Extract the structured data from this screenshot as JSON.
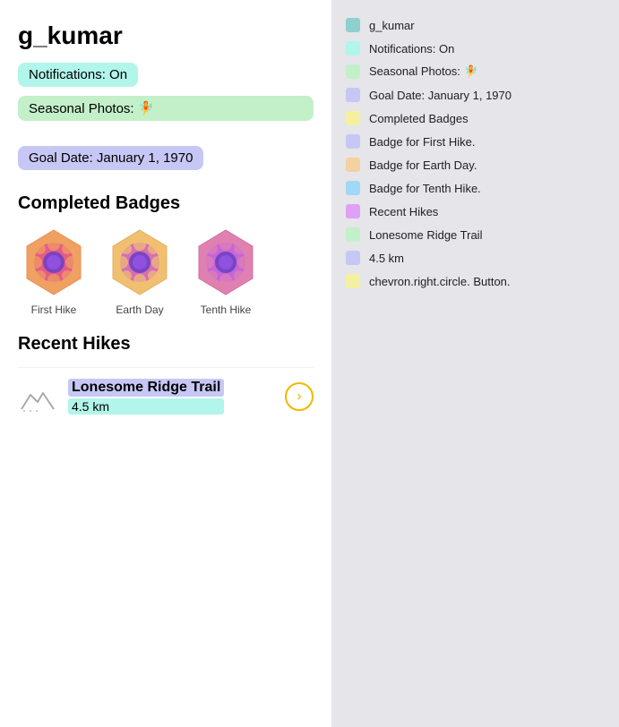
{
  "user": {
    "username": "g_kumar"
  },
  "info": {
    "notifications": "Notifications: On",
    "seasonal": "Seasonal Photos:",
    "seasonal_emoji": "🧚",
    "goaldate": "Goal Date: January 1, 1970"
  },
  "completed_badges": {
    "title": "Completed Badges",
    "items": [
      {
        "label": "First Hike",
        "color_outer": "#f0a060",
        "color_inner": "#e05090"
      },
      {
        "label": "Earth Day",
        "color_outer": "#f0c070",
        "color_inner": "#d060c0"
      },
      {
        "label": "Tenth Hike",
        "color_outer": "#e080b0",
        "color_inner": "#b060e0"
      }
    ]
  },
  "recent_hikes": {
    "title": "Recent Hikes",
    "items": [
      {
        "name": "Lonesome Ridge Trail",
        "distance": "4.5 km"
      }
    ]
  },
  "legend": {
    "items": [
      {
        "label": "g_kumar",
        "color": "#8ecfcf"
      },
      {
        "label": "Notifications: On",
        "color": "#b2f5ea"
      },
      {
        "label": "Seasonal Photos: 🧚",
        "color": "#c3f0c8"
      },
      {
        "label": "Goal Date: January 1, 1970",
        "color": "#c7c7f5"
      },
      {
        "label": "Completed Badges",
        "color": "#f5f0a0"
      },
      {
        "label": "Badge for First Hike.",
        "color": "#c7c7f5"
      },
      {
        "label": "Badge for Earth Day.",
        "color": "#f5d0a0"
      },
      {
        "label": "Badge for Tenth Hike.",
        "color": "#a0d8f5"
      },
      {
        "label": "Recent Hikes",
        "color": "#e0a0f5"
      },
      {
        "label": "Lonesome Ridge Trail",
        "color": "#c3f0c8"
      },
      {
        "label": "4.5 km",
        "color": "#c7c7f5"
      },
      {
        "label": "chevron.right.circle. Button.",
        "color": "#f5f0a0"
      }
    ]
  }
}
